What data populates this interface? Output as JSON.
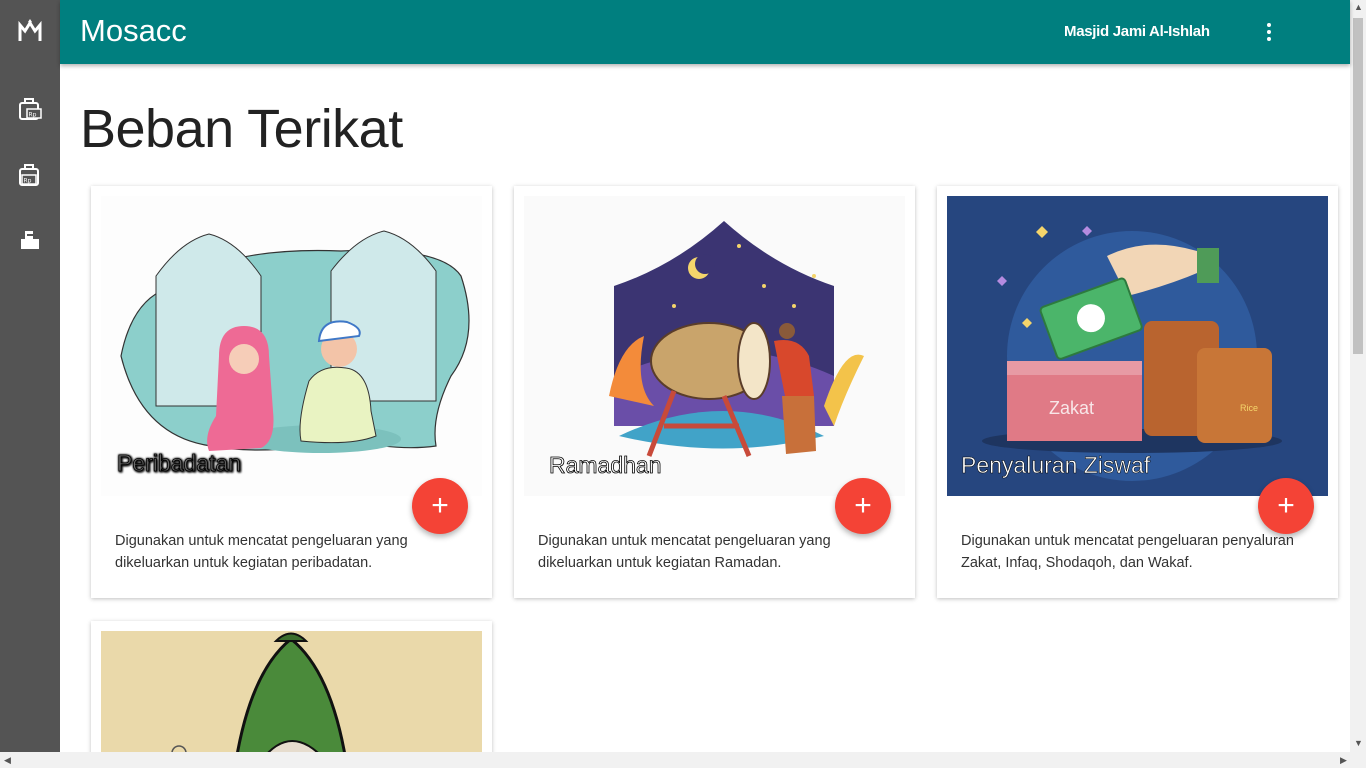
{
  "app": {
    "title": "Mosacc",
    "org_name": "Masjid Jami Al-Ishlah"
  },
  "page": {
    "title": "Beban Terikat"
  },
  "sidebar": {
    "items": [
      {
        "icon": "logo-icon"
      },
      {
        "icon": "income-rp-icon"
      },
      {
        "icon": "expense-rp-icon"
      },
      {
        "icon": "report-icon"
      }
    ]
  },
  "cards": [
    {
      "title": "Peribadatan",
      "description": "Digunakan untuk mencatat pengeluaran yang dikeluarkan untuk kegiatan peribadatan.",
      "add_label": "+"
    },
    {
      "title": "Ramadhan",
      "description": "Digunakan untuk mencatat pengeluaran yang dikeluarkan untuk kegiatan Ramadan.",
      "add_label": "+"
    },
    {
      "title": "Penyaluran Ziswaf",
      "description": "Digunakan untuk mencatat pengeluaran penyaluran Zakat, Infaq, Shodaqoh, dan Wakaf.",
      "add_label": "+"
    },
    {
      "title": ""
    }
  ],
  "illustration_text": {
    "zakat": "Zakat",
    "rice": "Rice"
  },
  "colors": {
    "sidebar": "#545454",
    "topbar": "#007f7f",
    "fab": "#f44336"
  }
}
